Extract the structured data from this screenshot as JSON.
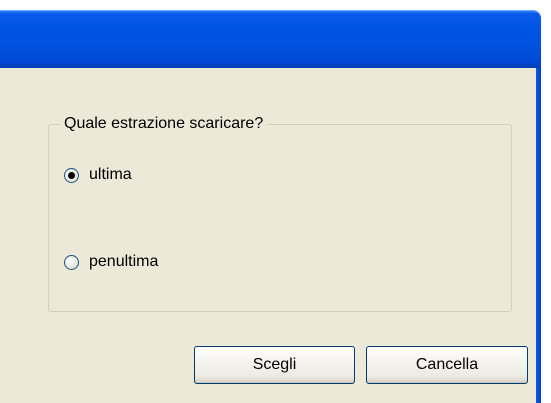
{
  "window": {
    "title": ""
  },
  "group": {
    "label": "Quale estrazione scaricare?",
    "options": [
      {
        "label": "ultima",
        "selected": true
      },
      {
        "label": "penultima",
        "selected": false
      }
    ]
  },
  "buttons": {
    "choose_label": "Scegli",
    "cancel_label": "Cancella"
  },
  "colors": {
    "titlebar": "#0055e5",
    "client_background": "#ece9d8"
  }
}
